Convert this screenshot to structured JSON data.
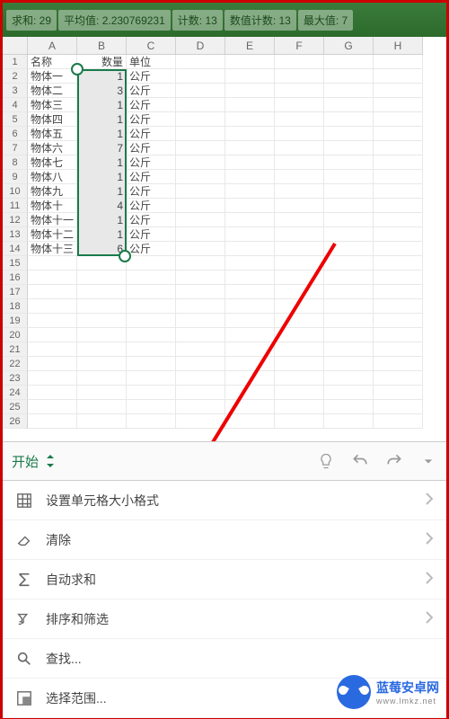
{
  "stats": {
    "sum_label": "求和: 29",
    "avg_label": "平均值: 2.230769231",
    "count_label": "计数: 13",
    "numcount_label": "数值计数: 13",
    "max_label": "最大值: 7"
  },
  "columns": [
    "A",
    "B",
    "C",
    "D",
    "E",
    "F",
    "G",
    "H"
  ],
  "rows": [
    {
      "n": 1,
      "a": "名称",
      "b": "数量",
      "c": "单位"
    },
    {
      "n": 2,
      "a": "物体一",
      "b": "1",
      "c": "公斤"
    },
    {
      "n": 3,
      "a": "物体二",
      "b": "3",
      "c": "公斤"
    },
    {
      "n": 4,
      "a": "物体三",
      "b": "1",
      "c": "公斤"
    },
    {
      "n": 5,
      "a": "物体四",
      "b": "1",
      "c": "公斤"
    },
    {
      "n": 6,
      "a": "物体五",
      "b": "1",
      "c": "公斤"
    },
    {
      "n": 7,
      "a": "物体六",
      "b": "7",
      "c": "公斤"
    },
    {
      "n": 8,
      "a": "物体七",
      "b": "1",
      "c": "公斤"
    },
    {
      "n": 9,
      "a": "物体八",
      "b": "1",
      "c": "公斤"
    },
    {
      "n": 10,
      "a": "物体九",
      "b": "1",
      "c": "公斤"
    },
    {
      "n": 11,
      "a": "物体十",
      "b": "4",
      "c": "公斤"
    },
    {
      "n": 12,
      "a": "物体十一",
      "b": "1",
      "c": "公斤"
    },
    {
      "n": 13,
      "a": "物体十二",
      "b": "1",
      "c": "公斤"
    },
    {
      "n": 14,
      "a": "物体十三",
      "b": "6",
      "c": "公斤"
    },
    {
      "n": 15
    },
    {
      "n": 16
    },
    {
      "n": 17
    },
    {
      "n": 18
    },
    {
      "n": 19
    },
    {
      "n": 20
    },
    {
      "n": 21
    },
    {
      "n": 22
    },
    {
      "n": 23
    },
    {
      "n": 24
    },
    {
      "n": 25
    },
    {
      "n": 26
    }
  ],
  "selection": {
    "range": "B2:B14"
  },
  "toolbar": {
    "tab": "开始"
  },
  "menu": {
    "format": "设置单元格大小格式",
    "clear": "清除",
    "autosum": "自动求和",
    "sortfilter": "排序和筛选",
    "find": "查找...",
    "selectrange": "选择范围..."
  },
  "watermark": {
    "brand": "蓝莓安卓网",
    "url": "www.lmkz.net"
  }
}
